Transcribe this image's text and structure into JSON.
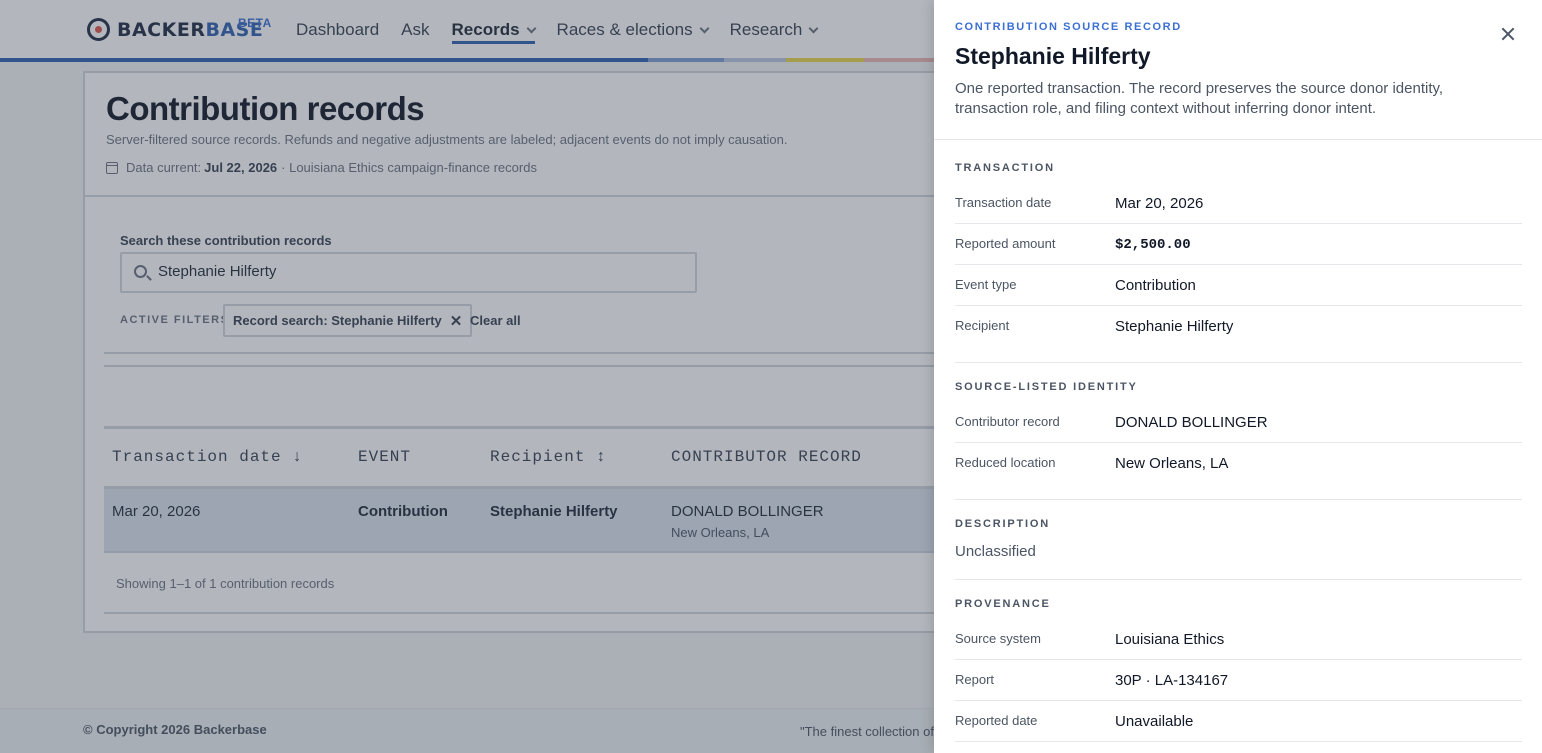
{
  "brand": {
    "name_part1": "BACKER",
    "name_part2": "BASE",
    "badge": "BETA"
  },
  "nav": {
    "dashboard": "Dashboard",
    "ask": "Ask",
    "records": "Records",
    "races": "Races & elections",
    "research": "Research"
  },
  "colors": {
    "accent": "#2f5fb0",
    "eyebrow": "#3b6fd4",
    "row_highlight": "#dbe3ef"
  },
  "page": {
    "title": "Contribution records",
    "subtitle": "Server-filtered source records. Refunds and negative adjustments are labeled; adjacent events do not imply causation.",
    "data_current_label": "Data current:",
    "data_current_date": "Jul 22, 2026",
    "data_current_source": "· Louisiana Ethics campaign-finance records"
  },
  "search": {
    "label": "Search these contribution records",
    "value": "Stephanie Hilferty",
    "active_filters_label": "ACTIVE FILTERS",
    "chip": "Record search: Stephanie Hilferty",
    "clear_all": "Clear all"
  },
  "table": {
    "headers": [
      "Transaction date ↓",
      "EVENT",
      "Recipient ↕",
      "CONTRIBUTOR RECORD"
    ],
    "rows": [
      {
        "date": "Mar 20, 2026",
        "event": "Contribution",
        "recipient": "Stephanie Hilferty",
        "contributor": "DONALD BOLLINGER",
        "location": "New Orleans, LA"
      }
    ],
    "showing": "Showing 1–1 of 1 contribution records"
  },
  "footer": {
    "copyright": "© Copyright 2026 Backerbase",
    "quote": "\"The finest collection of"
  },
  "drawer": {
    "eyebrow": "CONTRIBUTION SOURCE RECORD",
    "title": "Stephanie Hilferty",
    "description": "One reported transaction. The record preserves the source donor identity, transaction role, and filing context without inferring donor intent.",
    "transaction": {
      "heading": "TRANSACTION",
      "date_label": "Transaction date",
      "date": "Mar 20, 2026",
      "amount_label": "Reported amount",
      "amount": "$2,500.00",
      "event_label": "Event type",
      "event": "Contribution",
      "recipient_label": "Recipient",
      "recipient": "Stephanie Hilferty"
    },
    "identity": {
      "heading": "SOURCE-LISTED IDENTITY",
      "contributor_label": "Contributor record",
      "contributor": "DONALD BOLLINGER",
      "location_label": "Reduced location",
      "location": "New Orleans, LA"
    },
    "description_section": {
      "heading": "DESCRIPTION",
      "value": "Unclassified"
    },
    "provenance": {
      "heading": "PROVENANCE",
      "system_label": "Source system",
      "system": "Louisiana Ethics",
      "report_label": "Report",
      "report": "30P · LA-134167",
      "reported_date_label": "Reported date",
      "reported_date": "Unavailable"
    }
  }
}
